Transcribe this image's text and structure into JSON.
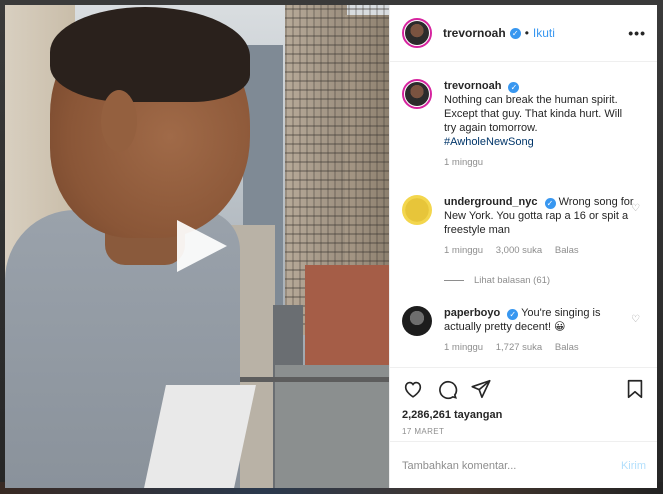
{
  "post": {
    "username": "trevornoah",
    "follow_label": "Ikuti",
    "separator": "•",
    "more_label": "•••"
  },
  "caption": {
    "username": "trevornoah",
    "text": "Nothing can break the human spirit. Except that guy. That kinda hurt. Will try again tomorrow.",
    "hashtag": "#AwholeNewSong",
    "time": "1 minggu"
  },
  "comments": [
    {
      "username": "underground_nyc",
      "text": "Wrong song for New York. You gotta rap a 16 or spit a freestyle man",
      "time": "1 minggu",
      "likes": "3,000 suka",
      "reply_label": "Balas"
    },
    {
      "username": "paperboyo",
      "text": "You're singing is actually pretty decent! 😀",
      "time": "1 minggu",
      "likes": "1,727 suka",
      "reply_label": "Balas"
    }
  ],
  "replies_label": "Lihat balasan (61)",
  "stats": {
    "views": "2,286,261 tayangan",
    "date": "17 MARET"
  },
  "composer": {
    "placeholder": "Tambahkan komentar...",
    "send_label": "Kirim"
  },
  "colors": {
    "link": "#3897f0",
    "muted": "#8e8e8e",
    "story_ring": "#d6249f"
  },
  "icons": [
    "play-icon",
    "verified-icon",
    "heart-icon",
    "comment-icon",
    "share-icon",
    "bookmark-icon"
  ]
}
